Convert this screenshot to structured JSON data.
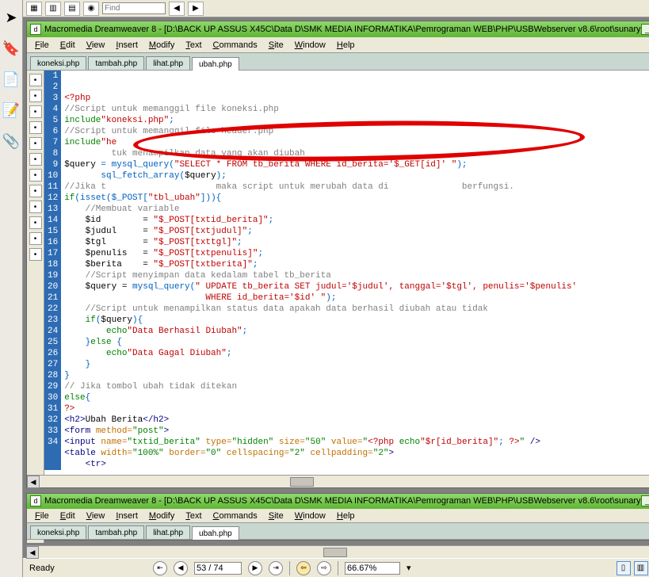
{
  "left_sidebar_icons": [
    "pointer-icon",
    "bookmark-icon",
    "copy-icon",
    "paperclip-icon",
    "note-icon"
  ],
  "top_toolbar": {
    "find_placeholder": "Find"
  },
  "window": {
    "title": "Macromedia Dreamweaver 8 - [D:\\BACK UP ASSUS X45C\\Data D\\SMK MEDIA INFORMATIKA\\Pemrograman WEB\\PHP\\USBWebserver v8.6\\root\\sunary",
    "menu": [
      "File",
      "Edit",
      "View",
      "Insert",
      "Modify",
      "Text",
      "Commands",
      "Site",
      "Window",
      "Help"
    ],
    "tabs": [
      {
        "label": "koneksi.php",
        "active": false
      },
      {
        "label": "tambah.php",
        "active": false
      },
      {
        "label": "lihat.php",
        "active": false
      },
      {
        "label": "ubah.php",
        "active": true
      }
    ],
    "code_tool_icons": [
      "split",
      "live",
      "design",
      "code",
      "refresh",
      "globe",
      "ruler",
      "help",
      "lock",
      "a",
      "b",
      "c"
    ]
  },
  "code": {
    "start_line": 1,
    "lines": [
      [
        {
          "t": "<?php",
          "c": "c-red"
        }
      ],
      [
        {
          "t": "//Script untuk memanggil file koneksi.php",
          "c": "c-gray"
        }
      ],
      [
        {
          "t": "include",
          "c": "c-green"
        },
        {
          "t": "\"koneksi.php\"",
          "c": "c-red"
        },
        {
          "t": ";",
          "c": "c-blue"
        }
      ],
      [
        {
          "t": "//Script untuk memanggil file header.php",
          "c": "c-gray"
        }
      ],
      [
        {
          "t": "include",
          "c": "c-green"
        },
        {
          "t": "\"he",
          "c": "c-red"
        }
      ],
      [
        {
          "t": "         tuk menampilkan data yang akan diubah",
          "c": "c-gray"
        }
      ],
      [
        {
          "t": "$query",
          "c": "c-black"
        },
        {
          "t": " = ",
          "c": "c-blue"
        },
        {
          "t": "mysql_query",
          "c": "c-blue"
        },
        {
          "t": "(",
          "c": "c-blue"
        },
        {
          "t": "\"SELECT * FROM tb_berita WHERE id_berita='$_GET[id]' \"",
          "c": "c-red"
        },
        {
          "t": ");",
          "c": "c-blue"
        }
      ],
      [
        {
          "t": "       ",
          "c": "c-black"
        },
        {
          "t": "sql_fetch_array",
          "c": "c-blue"
        },
        {
          "t": "(",
          "c": "c-blue"
        },
        {
          "t": "$query",
          "c": "c-black"
        },
        {
          "t": ");",
          "c": "c-blue"
        }
      ],
      [
        {
          "t": "//Jika t                     maka script untuk merubah data di              berfungsi.",
          "c": "c-gray"
        }
      ],
      [
        {
          "t": "if",
          "c": "c-green"
        },
        {
          "t": "(",
          "c": "c-blue"
        },
        {
          "t": "isset",
          "c": "c-blue"
        },
        {
          "t": "(",
          "c": "c-blue"
        },
        {
          "t": "$_POST",
          "c": "c-blue"
        },
        {
          "t": "[",
          "c": "c-blue"
        },
        {
          "t": "\"tbl_ubah\"",
          "c": "c-red"
        },
        {
          "t": "])){",
          "c": "c-blue"
        }
      ],
      [
        {
          "t": "    //Membuat variable",
          "c": "c-gray"
        }
      ],
      [
        {
          "t": "    $id        = ",
          "c": "c-black"
        },
        {
          "t": "\"$_POST[txtid_berita]\"",
          "c": "c-red"
        },
        {
          "t": ";",
          "c": "c-blue"
        }
      ],
      [
        {
          "t": "    $judul     = ",
          "c": "c-black"
        },
        {
          "t": "\"$_POST[txtjudul]\"",
          "c": "c-red"
        },
        {
          "t": ";",
          "c": "c-blue"
        }
      ],
      [
        {
          "t": "    $tgl       = ",
          "c": "c-black"
        },
        {
          "t": "\"$_POST[txttgl]\"",
          "c": "c-red"
        },
        {
          "t": ";",
          "c": "c-blue"
        }
      ],
      [
        {
          "t": "    $penulis   = ",
          "c": "c-black"
        },
        {
          "t": "\"$_POST[txtpenulis]\"",
          "c": "c-red"
        },
        {
          "t": ";",
          "c": "c-blue"
        }
      ],
      [
        {
          "t": "    $berita    = ",
          "c": "c-black"
        },
        {
          "t": "\"$_POST[txtberita]\"",
          "c": "c-red"
        },
        {
          "t": ";",
          "c": "c-blue"
        }
      ],
      [
        {
          "t": "    //Script menyimpan data kedalam tabel tb_berita",
          "c": "c-gray"
        }
      ],
      [
        {
          "t": "    $query = ",
          "c": "c-black"
        },
        {
          "t": "mysql_query",
          "c": "c-blue"
        },
        {
          "t": "(",
          "c": "c-blue"
        },
        {
          "t": "\" UPDATE tb_berita SET judul='$judul', tanggal='$tgl', penulis='$penulis'",
          "c": "c-red"
        }
      ],
      [
        {
          "t": "                           WHERE id_berita='$id' \"",
          "c": "c-red"
        },
        {
          "t": ");",
          "c": "c-blue"
        }
      ],
      [
        {
          "t": "    //Script untuk menampilkan status data apakah data berhasil diubah atau tidak",
          "c": "c-gray"
        }
      ],
      [
        {
          "t": "    if",
          "c": "c-green"
        },
        {
          "t": "(",
          "c": "c-blue"
        },
        {
          "t": "$query",
          "c": "c-black"
        },
        {
          "t": "){",
          "c": "c-blue"
        }
      ],
      [
        {
          "t": "        echo",
          "c": "c-green"
        },
        {
          "t": "\"Data Berhasil Diubah\"",
          "c": "c-red"
        },
        {
          "t": ";",
          "c": "c-blue"
        }
      ],
      [
        {
          "t": "    }",
          "c": "c-blue"
        },
        {
          "t": "else",
          "c": "c-green"
        },
        {
          "t": " {",
          "c": "c-blue"
        }
      ],
      [
        {
          "t": "        echo",
          "c": "c-green"
        },
        {
          "t": "\"Data Gagal Diubah\"",
          "c": "c-red"
        },
        {
          "t": ";",
          "c": "c-blue"
        }
      ],
      [
        {
          "t": "    }",
          "c": "c-blue"
        }
      ],
      [
        {
          "t": "}",
          "c": "c-blue"
        }
      ],
      [
        {
          "t": "// Jika tombol ubah tidak ditekan",
          "c": "c-gray"
        }
      ],
      [
        {
          "t": "else",
          "c": "c-green"
        },
        {
          "t": "{",
          "c": "c-blue"
        }
      ],
      [
        {
          "t": "?>",
          "c": "c-red"
        }
      ],
      [
        {
          "t": "<h2>",
          "c": "c-navy"
        },
        {
          "t": "Ubah Berita",
          "c": "c-black"
        },
        {
          "t": "</h2>",
          "c": "c-navy"
        }
      ],
      [
        {
          "t": "<form ",
          "c": "c-navy"
        },
        {
          "t": "method=",
          "c": "c-orange"
        },
        {
          "t": "\"post\"",
          "c": "c-green"
        },
        {
          "t": ">",
          "c": "c-navy"
        }
      ],
      [
        {
          "t": "<input ",
          "c": "c-navy"
        },
        {
          "t": "name=",
          "c": "c-orange"
        },
        {
          "t": "\"txtid_berita\"",
          "c": "c-green"
        },
        {
          "t": " type=",
          "c": "c-orange"
        },
        {
          "t": "\"hidden\"",
          "c": "c-green"
        },
        {
          "t": " size=",
          "c": "c-orange"
        },
        {
          "t": "\"50\"",
          "c": "c-green"
        },
        {
          "t": " value=",
          "c": "c-orange"
        },
        {
          "t": "\"",
          "c": "c-green"
        },
        {
          "t": "<?php ",
          "c": "c-red"
        },
        {
          "t": "echo",
          "c": "c-green"
        },
        {
          "t": "\"$r[id_berita]\"",
          "c": "c-red"
        },
        {
          "t": "; ",
          "c": "c-blue"
        },
        {
          "t": "?>",
          "c": "c-red"
        },
        {
          "t": "\"",
          "c": "c-green"
        },
        {
          "t": " />",
          "c": "c-navy"
        }
      ],
      [
        {
          "t": "<table ",
          "c": "c-navy"
        },
        {
          "t": "width=",
          "c": "c-orange"
        },
        {
          "t": "\"100%\"",
          "c": "c-green"
        },
        {
          "t": " border=",
          "c": "c-orange"
        },
        {
          "t": "\"0\"",
          "c": "c-green"
        },
        {
          "t": " cellspacing=",
          "c": "c-orange"
        },
        {
          "t": "\"2\"",
          "c": "c-green"
        },
        {
          "t": " cellpadding=",
          "c": "c-orange"
        },
        {
          "t": "\"2\"",
          "c": "c-green"
        },
        {
          "t": ">",
          "c": "c-navy"
        }
      ],
      [
        {
          "t": "    <tr>",
          "c": "c-navy"
        }
      ]
    ]
  },
  "window2": {
    "title": "Macromedia Dreamweaver 8 - [D:\\BACK UP ASSUS X45C\\Data D\\SMK MEDIA INFORMATIKA\\Pemrograman WEB\\PHP\\USBWebserver v8.6\\root\\sunary",
    "code_line_num": "34",
    "code_line": "    <tr>"
  },
  "statusbar": {
    "ready": "Ready",
    "page": "53 / 74",
    "zoom": "66.67%",
    "nav_icons": [
      "first",
      "prev",
      "next",
      "last",
      "back",
      "forward"
    ]
  }
}
